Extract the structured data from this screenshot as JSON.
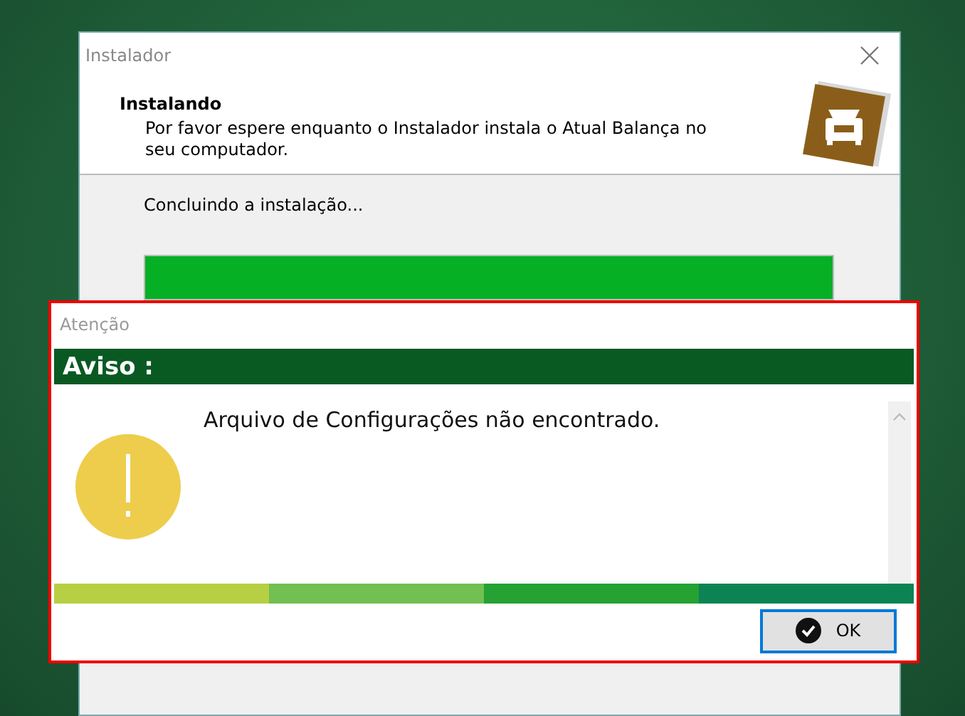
{
  "installer": {
    "title": "Instalador",
    "heading": "Instalando",
    "description": "Por favor espere enquanto o Instalador instala o Atual Balança no seu computador.",
    "status": "Concluindo a instalação...",
    "progress": {
      "level": 1
    }
  },
  "alert": {
    "title": "Atenção",
    "header": "Aviso :",
    "message": "Arquivo de Configurações não encontrado.",
    "buttons": [
      "OK"
    ]
  }
}
